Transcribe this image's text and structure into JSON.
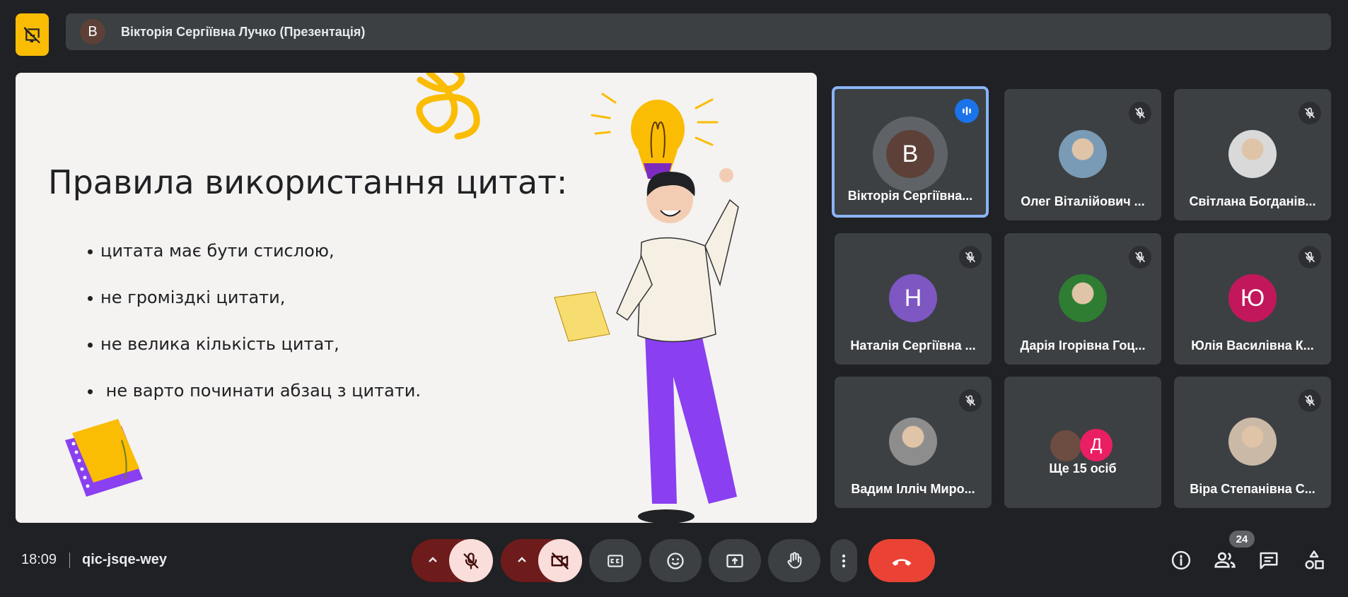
{
  "header": {
    "presenter_initial": "В",
    "presenter_title": "Вікторія Сергіївна Лучко (Презентація)"
  },
  "slide": {
    "title": "Правила використання цитат:",
    "bullets": [
      "цитата має бути стислою,",
      "не громіздкі цитати,",
      "не велика кількість цитат,",
      " не варто починати абзац з цитати."
    ]
  },
  "tiles": [
    {
      "name": "Вікторія Сергіївна...",
      "initial": "В",
      "avatar_color": "#5d4037",
      "kind": "letter",
      "speaking": true
    },
    {
      "name": "Олег Віталійович ...",
      "initial": "",
      "avatar_color": "#7a9bb5",
      "kind": "photo",
      "speaking": false
    },
    {
      "name": "Світлана Богданів...",
      "initial": "",
      "avatar_color": "#d9d9d9",
      "kind": "photo",
      "speaking": false
    },
    {
      "name": "Наталія Сергіївна ...",
      "initial": "Н",
      "avatar_color": "#7e57c2",
      "kind": "letter",
      "speaking": false
    },
    {
      "name": "Дарія Ігорівна Гоц...",
      "initial": "",
      "avatar_color": "#2e7d32",
      "kind": "photo",
      "speaking": false
    },
    {
      "name": "Юлія Василівна К...",
      "initial": "Ю",
      "avatar_color": "#c2185b",
      "kind": "letter",
      "speaking": false
    },
    {
      "name": "Вадим Ілліч Миро...",
      "initial": "",
      "avatar_color": "#8d8d8d",
      "kind": "photo",
      "speaking": false
    },
    {
      "name": "Ще 15 осіб",
      "initial": "Д",
      "avatar_color": "#e91e63",
      "kind": "more",
      "speaking": false
    },
    {
      "name": "Віра Степанівна С...",
      "initial": "",
      "avatar_color": "#c9b9a6",
      "kind": "photo",
      "speaking": false
    }
  ],
  "footer": {
    "time": "18:09",
    "meeting_code": "qic-jsqe-wey",
    "participants_count": "24"
  },
  "colors": {
    "background": "#202124",
    "tile": "#3c4043",
    "accent_blue": "#8ab4f8",
    "hangup_red": "#ea4335",
    "present_yellow": "#fbbc04"
  },
  "icons": [
    "present-stopped-icon",
    "mic-off-icon",
    "camera-off-icon",
    "captions-icon",
    "emoji-icon",
    "present-screen-icon",
    "raise-hand-icon",
    "more-vert-icon",
    "call-end-icon",
    "info-icon",
    "people-icon",
    "chat-icon",
    "activities-icon"
  ]
}
